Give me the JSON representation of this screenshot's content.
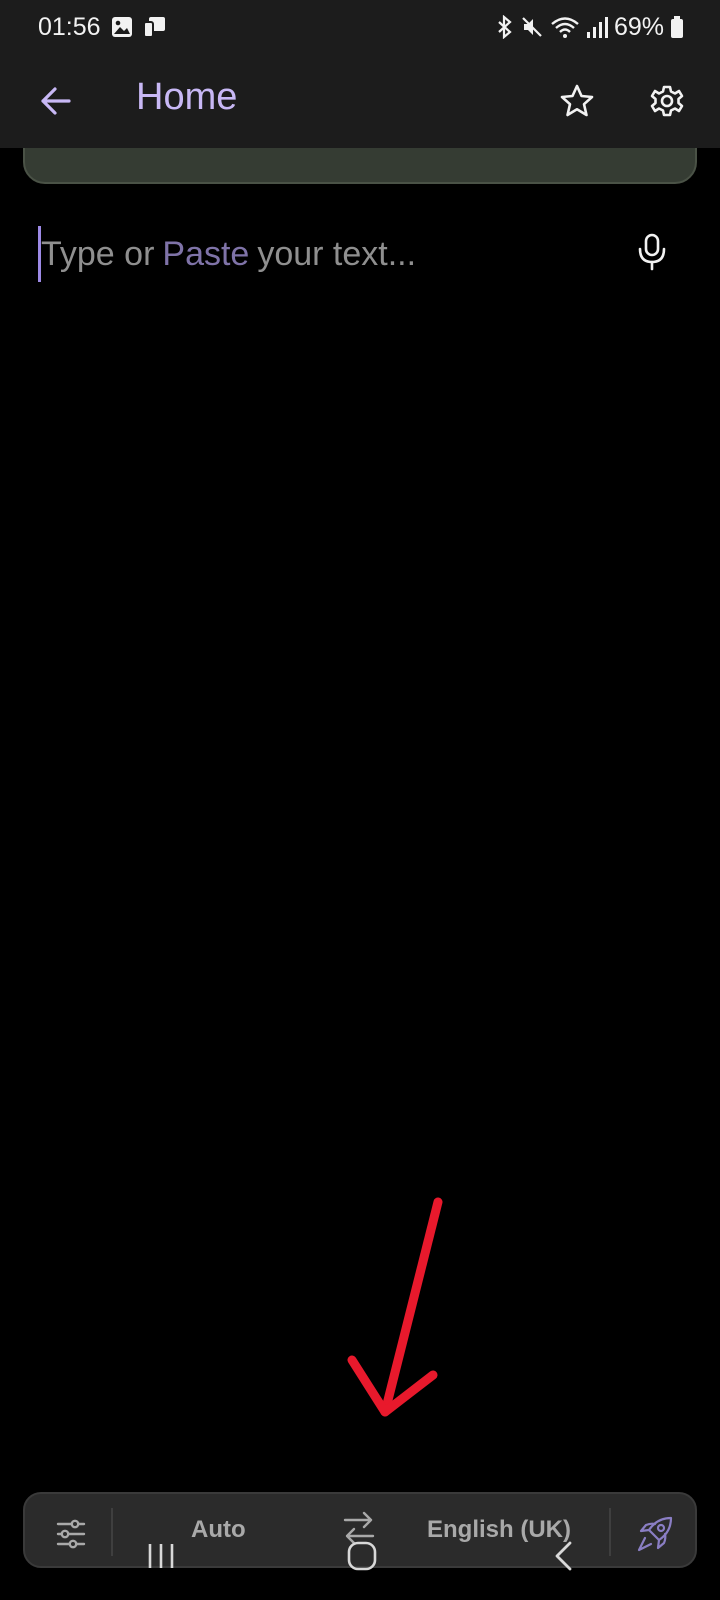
{
  "status_bar": {
    "time": "01:56",
    "battery": "69%",
    "icons": [
      "image-notification-icon",
      "cast-notification-icon",
      "bluetooth-icon",
      "mute-icon",
      "wifi-icon",
      "signal-icon",
      "battery-icon"
    ]
  },
  "app_bar": {
    "title": "Home",
    "icons": [
      "back-arrow-icon",
      "star-icon",
      "gear-icon"
    ]
  },
  "input": {
    "placeholder_part1": "Type or",
    "placeholder_paste": "Paste",
    "placeholder_part2": "your text..."
  },
  "bottom_bar": {
    "source_language": "Auto",
    "target_language": "English (UK)",
    "icons": [
      "sliders-icon",
      "swap-icon",
      "rocket-icon"
    ]
  },
  "colors": {
    "accent": "#c8b8f5",
    "caret": "#9d8ae6",
    "annotation": "#e8192c",
    "card": "#353c33"
  }
}
